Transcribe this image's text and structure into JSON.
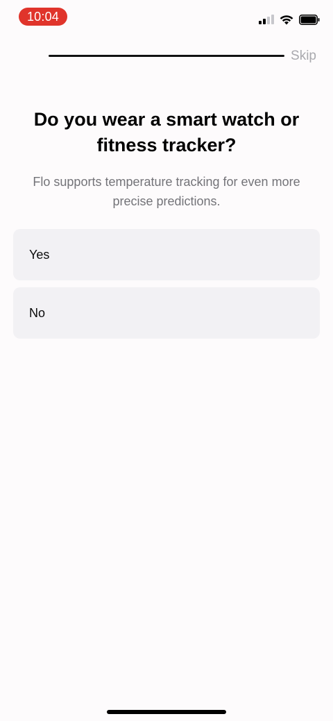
{
  "status_bar": {
    "time": "10:04",
    "time_pill_color": "#e0342b",
    "signal_icon": "cellular-signal-icon",
    "wifi_icon": "wifi-icon",
    "battery_icon": "battery-icon"
  },
  "header": {
    "progress": 1.0,
    "skip_label": "Skip"
  },
  "question": {
    "title": "Do you wear a smart watch or fitness tracker?",
    "subtitle": "Flo supports temperature tracking for even more precise predictions."
  },
  "options": [
    {
      "label": "Yes"
    },
    {
      "label": "No"
    }
  ]
}
